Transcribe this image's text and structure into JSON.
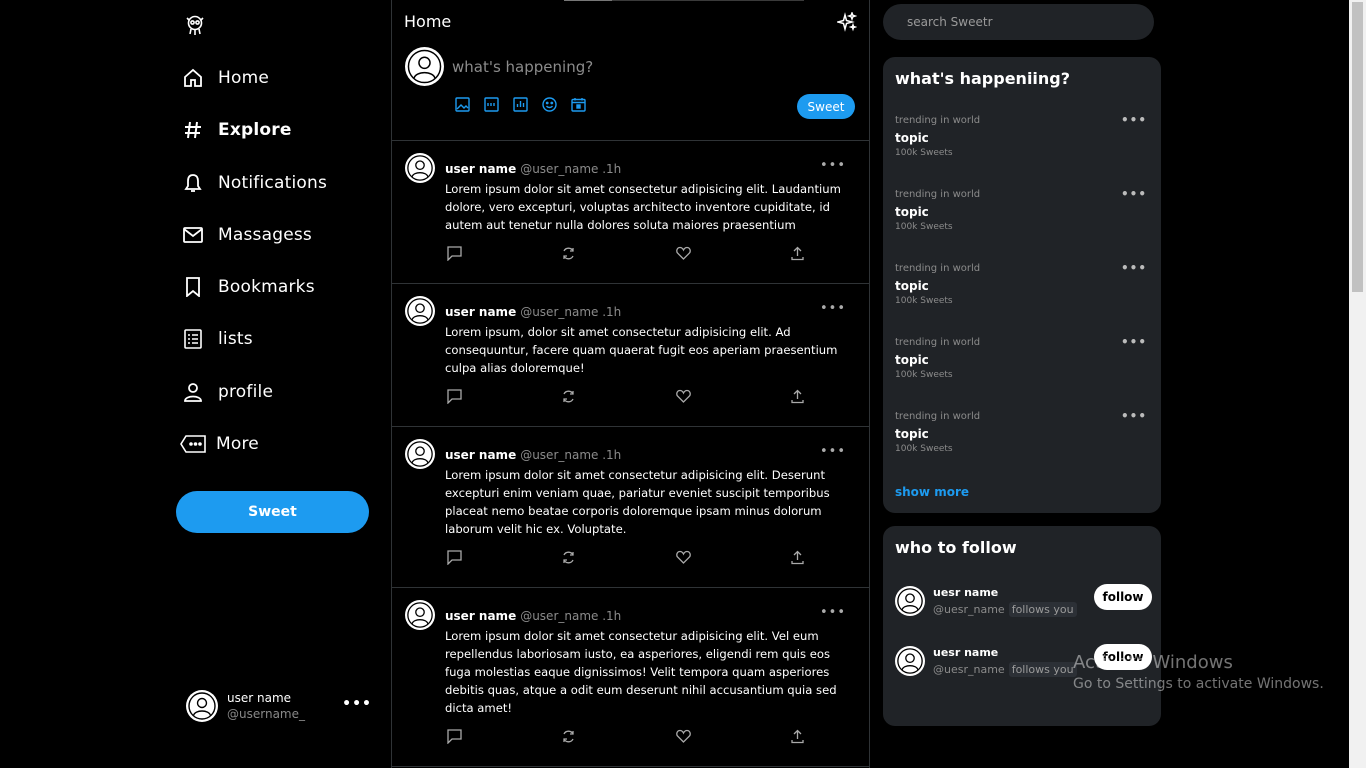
{
  "sidebar": {
    "items": [
      {
        "label": "Home",
        "icon": "home-icon"
      },
      {
        "label": "Explore",
        "icon": "hashtag-icon"
      },
      {
        "label": "Notifications",
        "icon": "bell-icon"
      },
      {
        "label": "Massagess",
        "icon": "mail-icon"
      },
      {
        "label": "Bookmarks",
        "icon": "bookmark-icon"
      },
      {
        "label": "lists",
        "icon": "list-icon"
      },
      {
        "label": "profile",
        "icon": "user-icon"
      },
      {
        "label": "More",
        "icon": "more-icon"
      }
    ],
    "sweet_label": "Sweet",
    "account": {
      "name": "user name",
      "handle": "@username_",
      "more": "•••"
    }
  },
  "feed": {
    "title": "Home",
    "composer_placeholder": "what's happening?",
    "post_label": "Sweet",
    "tweets": [
      {
        "user": "user name",
        "handle": "@user_name .1h",
        "text": "Lorem ipsum dolor sit amet consectetur adipisicing elit. Laudantium dolore, vero excepturi, voluptas architecto inventore cupiditate, id autem aut tenetur nulla dolores soluta maiores praesentium"
      },
      {
        "user": "user name",
        "handle": "@user_name .1h",
        "text": "Lorem ipsum, dolor sit amet consectetur adipisicing elit. Ad consequuntur, facere quam quaerat fugit eos aperiam praesentium culpa alias doloremque!"
      },
      {
        "user": "user name",
        "handle": "@user_name .1h",
        "text": "Lorem ipsum dolor sit amet consectetur adipisicing elit. Deserunt excepturi enim veniam quae, pariatur eveniet suscipit temporibus placeat nemo beatae corporis doloremque ipsam minus dolorum laborum velit hic ex. Voluptate."
      },
      {
        "user": "user name",
        "handle": "@user_name .1h",
        "text": "Lorem ipsum dolor sit amet consectetur adipisicing elit. Vel eum repellendus laboriosam iusto, ea asperiores, eligendi rem quis eos fuga molestias eaque dignissimos! Velit tempora quam asperiores debitis quas, atque a odit eum deserunt nihil accusantium quia sed dicta amet!"
      }
    ]
  },
  "search": {
    "placeholder": "search Sweetr"
  },
  "trends": {
    "title": "what's happeniing?",
    "items": [
      {
        "context": "trending in world",
        "topic": "topic",
        "count": "100k Sweets"
      },
      {
        "context": "trending in world",
        "topic": "topic",
        "count": "100k Sweets"
      },
      {
        "context": "trending in world",
        "topic": "topic",
        "count": "100k Sweets"
      },
      {
        "context": "trending in world",
        "topic": "topic",
        "count": "100k Sweets"
      },
      {
        "context": "trending in world",
        "topic": "topic",
        "count": "100k Sweets"
      }
    ],
    "dots": "•••",
    "show_more": "show more"
  },
  "who_to_follow": {
    "title": "who to follow",
    "items": [
      {
        "name": "uesr name",
        "handle": "@uesr_name",
        "follows_you": "follows you",
        "button": "follow"
      },
      {
        "name": "uesr name",
        "handle": "@uesr_name",
        "follows_you": "follows you",
        "button": "follow"
      }
    ]
  },
  "watermark": {
    "line1": "Activate Windows",
    "line2": "Go to Settings to activate Windows."
  },
  "colors": {
    "accent": "#1d9bf0",
    "background": "#000000",
    "panel": "#202327"
  }
}
